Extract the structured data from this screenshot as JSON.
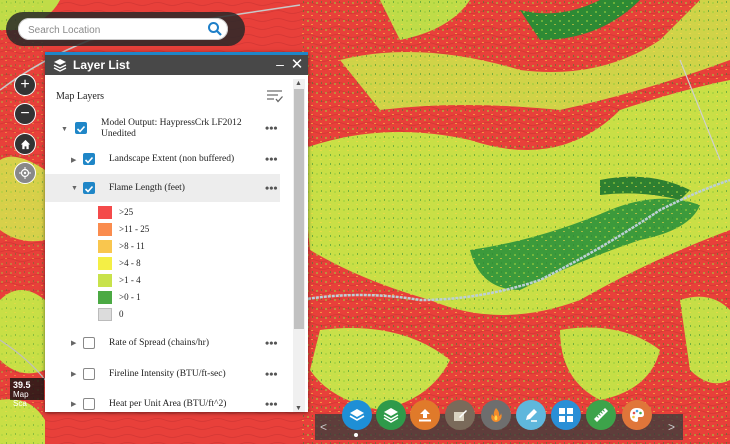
{
  "search": {
    "placeholder": "Search Location"
  },
  "map": {
    "scale_value": "39.5",
    "scale_label": "Map Sca"
  },
  "panel": {
    "title": "Layer List",
    "section_title": "Map Layers",
    "layers": [
      {
        "label": "Model Output: HaypressCrk LF2012",
        "label2": "Unedited",
        "checked": true,
        "more": "•••"
      },
      {
        "label": "Landscape Extent (non buffered)",
        "checked": true,
        "more": "•••"
      },
      {
        "label": "Flame Length (feet)",
        "checked": true,
        "more": "•••"
      },
      {
        "label": "Rate of Spread (chains/hr)",
        "checked": false,
        "more": "•••"
      },
      {
        "label": "Fireline Intensity (BTU/ft-sec)",
        "checked": false,
        "more": "•••"
      },
      {
        "label": "Heat per Unit Area (BTU/ft^2)",
        "checked": false,
        "more": "•••"
      }
    ],
    "legend": [
      {
        "label": ">25",
        "color": "#f44a4a"
      },
      {
        "label": ">11 - 25",
        "color": "#fa8c4e"
      },
      {
        "label": ">8 - 11",
        "color": "#f9c64e"
      },
      {
        "label": ">4 - 8",
        "color": "#f4ef45"
      },
      {
        "label": ">1 - 4",
        "color": "#c8e24b"
      },
      {
        "label": ">0 - 1",
        "color": "#4ba943"
      },
      {
        "label": "0",
        "color": "#dcdcdc"
      }
    ]
  },
  "toolbar": {
    "tools": [
      {
        "name": "layer-list-tool",
        "color": "#1e8fd6"
      },
      {
        "name": "basemap-tool",
        "color": "#2e9a4a"
      },
      {
        "name": "upload-tool",
        "color": "#e07a2a"
      },
      {
        "name": "edit-tool",
        "color": "#7a6a5a"
      },
      {
        "name": "fire-tool",
        "color": "#6e6e6e"
      },
      {
        "name": "draw-tool",
        "color": "#5fb7dc"
      },
      {
        "name": "grid-tool",
        "color": "#2a8fd6"
      },
      {
        "name": "measure-tool",
        "color": "#3da34a"
      },
      {
        "name": "palette-tool",
        "color": "#e0763a"
      }
    ]
  }
}
